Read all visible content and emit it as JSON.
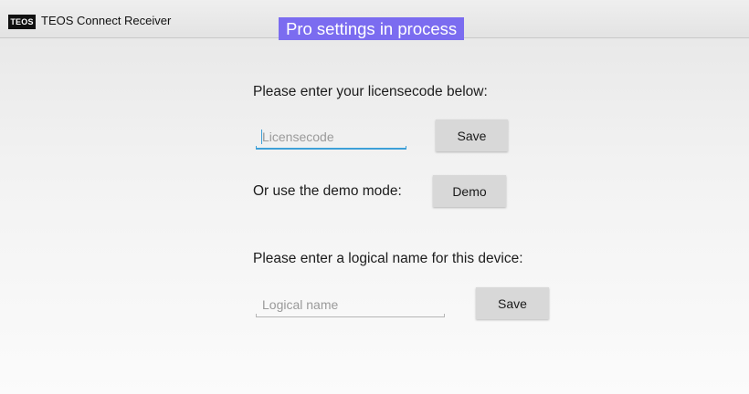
{
  "titlebar": {
    "logo_text": "TEOS",
    "app_title": "TEOS Connect Receiver"
  },
  "status_banner": {
    "text": "Pro settings in process",
    "color": "#7b6cf0"
  },
  "license": {
    "prompt": "Please enter your licensecode below:",
    "input_placeholder": "Licensecode",
    "input_value": "",
    "save_label": "Save"
  },
  "demo": {
    "prompt": "Or use the demo mode:",
    "button_label": "Demo"
  },
  "device": {
    "prompt": "Please enter a logical name for this device:",
    "input_placeholder": "Logical name",
    "input_value": "",
    "save_label": "Save"
  },
  "colors": {
    "focus_accent": "#3ea0d8",
    "button_bg": "#d8d8d8"
  }
}
